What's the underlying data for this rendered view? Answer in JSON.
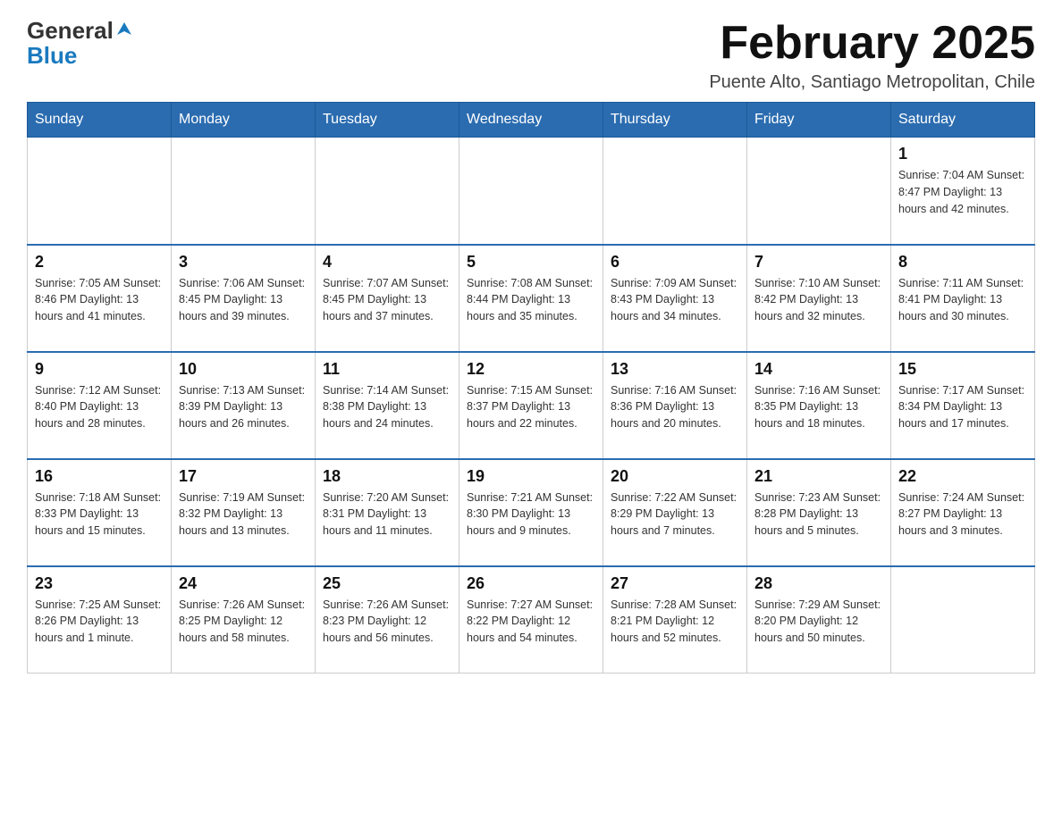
{
  "header": {
    "logo_general": "General",
    "logo_blue": "Blue",
    "month_title": "February 2025",
    "location": "Puente Alto, Santiago Metropolitan, Chile"
  },
  "days_of_week": [
    "Sunday",
    "Monday",
    "Tuesday",
    "Wednesday",
    "Thursday",
    "Friday",
    "Saturday"
  ],
  "weeks": [
    {
      "days": [
        {
          "num": "",
          "info": ""
        },
        {
          "num": "",
          "info": ""
        },
        {
          "num": "",
          "info": ""
        },
        {
          "num": "",
          "info": ""
        },
        {
          "num": "",
          "info": ""
        },
        {
          "num": "",
          "info": ""
        },
        {
          "num": "1",
          "info": "Sunrise: 7:04 AM\nSunset: 8:47 PM\nDaylight: 13 hours and 42 minutes."
        }
      ]
    },
    {
      "days": [
        {
          "num": "2",
          "info": "Sunrise: 7:05 AM\nSunset: 8:46 PM\nDaylight: 13 hours and 41 minutes."
        },
        {
          "num": "3",
          "info": "Sunrise: 7:06 AM\nSunset: 8:45 PM\nDaylight: 13 hours and 39 minutes."
        },
        {
          "num": "4",
          "info": "Sunrise: 7:07 AM\nSunset: 8:45 PM\nDaylight: 13 hours and 37 minutes."
        },
        {
          "num": "5",
          "info": "Sunrise: 7:08 AM\nSunset: 8:44 PM\nDaylight: 13 hours and 35 minutes."
        },
        {
          "num": "6",
          "info": "Sunrise: 7:09 AM\nSunset: 8:43 PM\nDaylight: 13 hours and 34 minutes."
        },
        {
          "num": "7",
          "info": "Sunrise: 7:10 AM\nSunset: 8:42 PM\nDaylight: 13 hours and 32 minutes."
        },
        {
          "num": "8",
          "info": "Sunrise: 7:11 AM\nSunset: 8:41 PM\nDaylight: 13 hours and 30 minutes."
        }
      ]
    },
    {
      "days": [
        {
          "num": "9",
          "info": "Sunrise: 7:12 AM\nSunset: 8:40 PM\nDaylight: 13 hours and 28 minutes."
        },
        {
          "num": "10",
          "info": "Sunrise: 7:13 AM\nSunset: 8:39 PM\nDaylight: 13 hours and 26 minutes."
        },
        {
          "num": "11",
          "info": "Sunrise: 7:14 AM\nSunset: 8:38 PM\nDaylight: 13 hours and 24 minutes."
        },
        {
          "num": "12",
          "info": "Sunrise: 7:15 AM\nSunset: 8:37 PM\nDaylight: 13 hours and 22 minutes."
        },
        {
          "num": "13",
          "info": "Sunrise: 7:16 AM\nSunset: 8:36 PM\nDaylight: 13 hours and 20 minutes."
        },
        {
          "num": "14",
          "info": "Sunrise: 7:16 AM\nSunset: 8:35 PM\nDaylight: 13 hours and 18 minutes."
        },
        {
          "num": "15",
          "info": "Sunrise: 7:17 AM\nSunset: 8:34 PM\nDaylight: 13 hours and 17 minutes."
        }
      ]
    },
    {
      "days": [
        {
          "num": "16",
          "info": "Sunrise: 7:18 AM\nSunset: 8:33 PM\nDaylight: 13 hours and 15 minutes."
        },
        {
          "num": "17",
          "info": "Sunrise: 7:19 AM\nSunset: 8:32 PM\nDaylight: 13 hours and 13 minutes."
        },
        {
          "num": "18",
          "info": "Sunrise: 7:20 AM\nSunset: 8:31 PM\nDaylight: 13 hours and 11 minutes."
        },
        {
          "num": "19",
          "info": "Sunrise: 7:21 AM\nSunset: 8:30 PM\nDaylight: 13 hours and 9 minutes."
        },
        {
          "num": "20",
          "info": "Sunrise: 7:22 AM\nSunset: 8:29 PM\nDaylight: 13 hours and 7 minutes."
        },
        {
          "num": "21",
          "info": "Sunrise: 7:23 AM\nSunset: 8:28 PM\nDaylight: 13 hours and 5 minutes."
        },
        {
          "num": "22",
          "info": "Sunrise: 7:24 AM\nSunset: 8:27 PM\nDaylight: 13 hours and 3 minutes."
        }
      ]
    },
    {
      "days": [
        {
          "num": "23",
          "info": "Sunrise: 7:25 AM\nSunset: 8:26 PM\nDaylight: 13 hours and 1 minute."
        },
        {
          "num": "24",
          "info": "Sunrise: 7:26 AM\nSunset: 8:25 PM\nDaylight: 12 hours and 58 minutes."
        },
        {
          "num": "25",
          "info": "Sunrise: 7:26 AM\nSunset: 8:23 PM\nDaylight: 12 hours and 56 minutes."
        },
        {
          "num": "26",
          "info": "Sunrise: 7:27 AM\nSunset: 8:22 PM\nDaylight: 12 hours and 54 minutes."
        },
        {
          "num": "27",
          "info": "Sunrise: 7:28 AM\nSunset: 8:21 PM\nDaylight: 12 hours and 52 minutes."
        },
        {
          "num": "28",
          "info": "Sunrise: 7:29 AM\nSunset: 8:20 PM\nDaylight: 12 hours and 50 minutes."
        },
        {
          "num": "",
          "info": ""
        }
      ]
    }
  ]
}
